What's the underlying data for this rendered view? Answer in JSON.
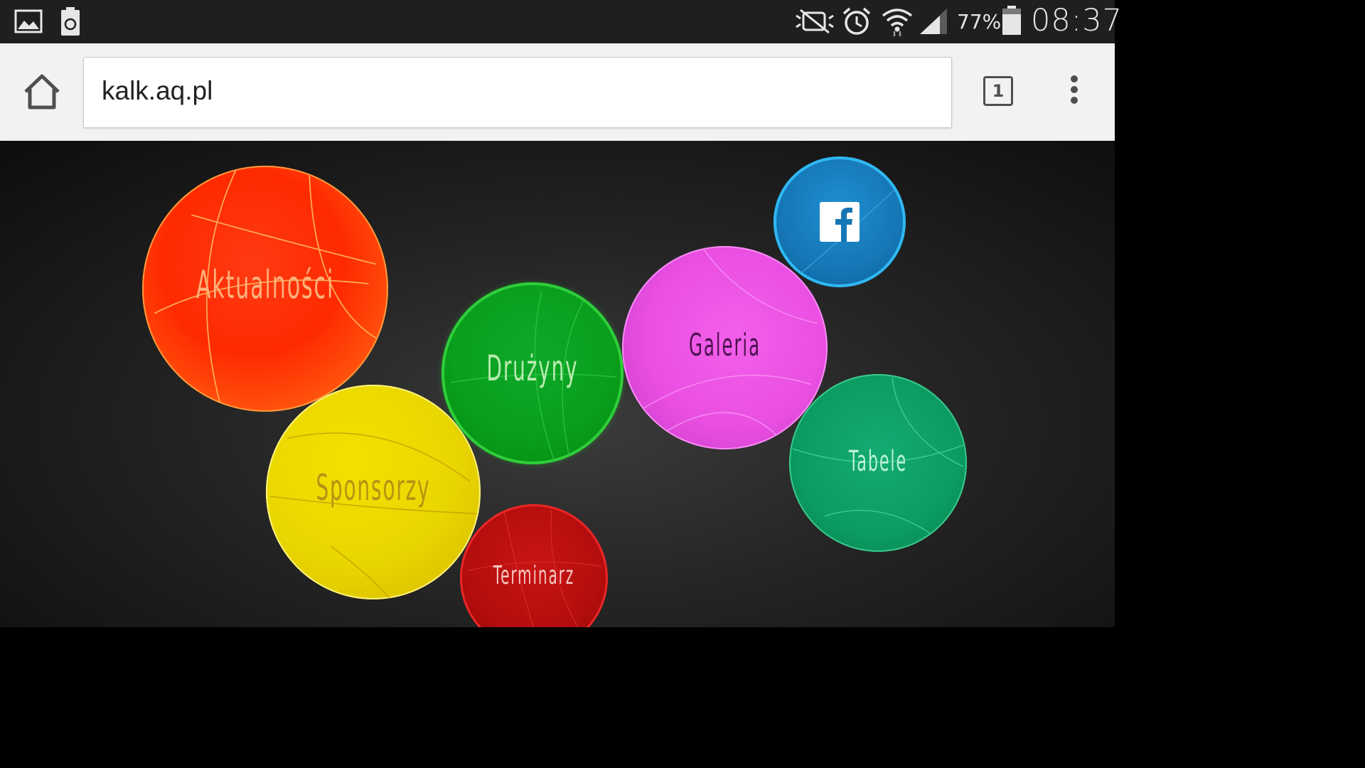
{
  "status_bar": {
    "icons": [
      "image-icon",
      "battery-saver-icon",
      "mute-icon",
      "alarm-icon",
      "wifi-icon",
      "signal-icon",
      "battery-icon"
    ],
    "battery_percent": "77%",
    "time": "08:37"
  },
  "browser": {
    "url": "kalk.aq.pl",
    "tab_count": "1",
    "icons": [
      "home-icon",
      "tabs-icon",
      "overflow-menu-icon"
    ]
  },
  "page": {
    "menu": [
      {
        "id": "aktualnosci",
        "label": "Aktualności",
        "color": "#ff2a00"
      },
      {
        "id": "sponsorzy",
        "label": "Sponsorzy",
        "color": "#e8d600"
      },
      {
        "id": "druzyny",
        "label": "Drużyny",
        "color": "#0a9f1c"
      },
      {
        "id": "galeria",
        "label": "Galeria",
        "color": "#ea4fe2"
      },
      {
        "id": "tabele",
        "label": "Tabele",
        "color": "#0b9c62"
      },
      {
        "id": "terminarz",
        "label": "Terminarz",
        "color": "#b30d0d"
      }
    ],
    "social": {
      "icon": "facebook-icon",
      "color": "#1576b5"
    }
  }
}
